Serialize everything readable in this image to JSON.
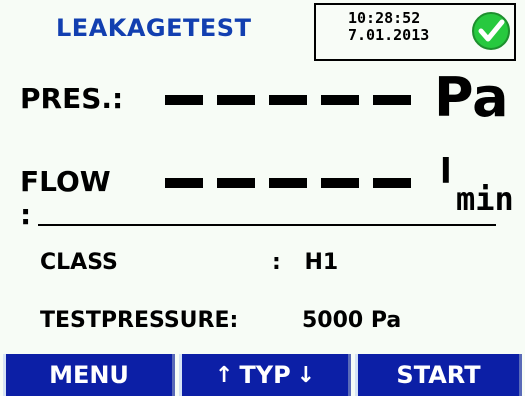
{
  "header": {
    "title": "LEAKAGETEST",
    "time": "10:28:52",
    "date": "7.01.2013",
    "status_icon": "check-circle-icon",
    "status_color": "#27c93f"
  },
  "measurements": {
    "pressure": {
      "label": "PRES.:",
      "value": "-----",
      "unit": "Pa"
    },
    "flow": {
      "label": "FLOW :",
      "value": "-----",
      "unit_numerator": "l",
      "unit_denominator": "min"
    }
  },
  "settings": {
    "class": {
      "label": "CLASS",
      "separator": ":",
      "value": "H1"
    },
    "testpressure": {
      "label": "TESTPRESSURE:",
      "value": "5000 Pa"
    }
  },
  "softkeys": {
    "menu": "MENU",
    "typ": "TYP",
    "typ_up_icon": "arrow-up-icon",
    "typ_down_icon": "arrow-down-icon",
    "start": "START"
  },
  "colors": {
    "title": "#123fb0",
    "softkey_bg": "#0c1fa6",
    "background": "#f7fcf6"
  }
}
